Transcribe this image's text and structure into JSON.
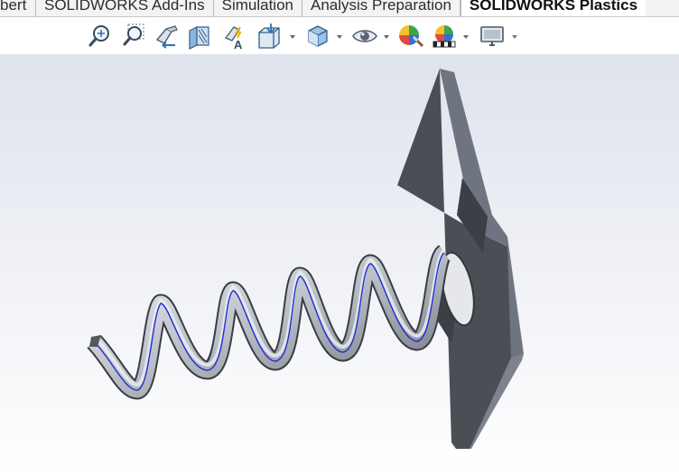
{
  "tabs": [
    {
      "label": "bert",
      "active": false
    },
    {
      "label": "SOLIDWORKS Add-Ins",
      "active": false
    },
    {
      "label": "Simulation",
      "active": false
    },
    {
      "label": "Analysis Preparation",
      "active": false
    },
    {
      "label": "SOLIDWORKS Plastics",
      "active": true
    }
  ],
  "toolbar": {
    "icons": [
      "zoom-to-fit-icon",
      "zoom-to-area-icon",
      "previous-view-icon",
      "section-view-icon",
      "dynamic-annotation-views-icon",
      "view-orientation-icon",
      "display-style-icon",
      "hide-show-items-icon",
      "edit-appearance-icon",
      "apply-scene-icon",
      "view-settings-icon"
    ]
  },
  "colors": {
    "accent_blue": "#2f6fb5",
    "plate_face": "#4b4e55",
    "plate_edge": "#6f7580",
    "spring_body": "#8a8f98",
    "spring_highlight": "#e9ebef",
    "spring_centerline": "#1f2bd6",
    "viewport_top": "#dfe3ec",
    "viewport_bottom": "#ffffff"
  }
}
